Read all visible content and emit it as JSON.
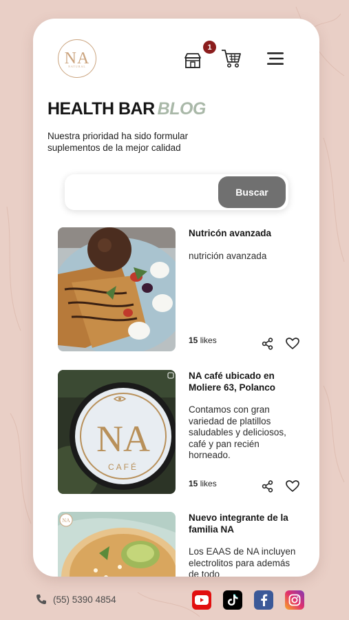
{
  "brand": {
    "logo_text": "NA",
    "logo_sub": "NATURAL"
  },
  "header": {
    "cart_count": "1"
  },
  "hero": {
    "title": "HEALTH BAR",
    "title_accent": "BLOG",
    "subtitle": "Nuestra prioridad ha sido formular suplementos de la mejor calidad"
  },
  "search": {
    "placeholder": "",
    "button_label": "Buscar"
  },
  "posts": [
    {
      "title": "Nutricón avanzada",
      "text": "nutrición avanzada",
      "likes_count": "15",
      "likes_label": "likes"
    },
    {
      "title": "NA café ubicado en Moliere 63, Polanco",
      "text": "Contamos con gran variedad de platillos saludables y deliciosos, café y pan recién horneado.",
      "likes_count": "15",
      "likes_label": "likes",
      "img_logo": "NA",
      "img_sub": "CAFÉ"
    },
    {
      "title": "Nuevo integrante de la familia NA",
      "text": "Los EAAS de NA incluyen electrolitos para además de todo"
    }
  ],
  "footer": {
    "phone": "(55) 5390 4854"
  },
  "colors": {
    "accent_sage": "#a9b8a8",
    "badge": "#8b1d1d",
    "search_button": "#707070",
    "background": "#e9cfc6"
  }
}
